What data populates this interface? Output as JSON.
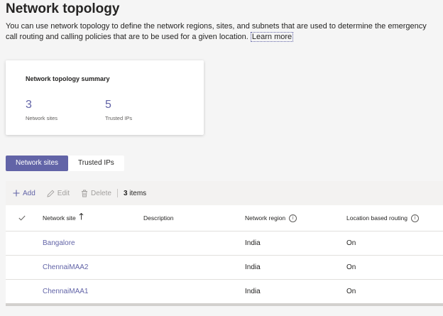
{
  "page": {
    "title": "Network topology",
    "description": "You can use network topology to define the network regions, sites, and subnets that are used to determine the emergency call routing and calling policies that are to be used for a given location.",
    "learn_more": "Learn more"
  },
  "summary": {
    "title": "Network topology summary",
    "stats": [
      {
        "value": "3",
        "label": "Network sites"
      },
      {
        "value": "5",
        "label": "Trusted IPs"
      }
    ]
  },
  "tabs": [
    {
      "label": "Network sites",
      "active": true
    },
    {
      "label": "Trusted IPs",
      "active": false
    }
  ],
  "toolbar": {
    "add": "Add",
    "edit": "Edit",
    "delete": "Delete",
    "count": "3",
    "count_suffix": "items"
  },
  "table": {
    "columns": [
      "Network site",
      "Description",
      "Network region",
      "Location based routing"
    ],
    "rows": [
      {
        "site": "Bangalore",
        "description": "",
        "region": "India",
        "lbr": "On"
      },
      {
        "site": "ChennaiMAA2",
        "description": "",
        "region": "India",
        "lbr": "On"
      },
      {
        "site": "ChennaiMAA1",
        "description": "",
        "region": "India",
        "lbr": "On"
      }
    ]
  },
  "colors": {
    "accent": "#6264a7",
    "background": "#f5f5f5"
  },
  "icons": {
    "add": "plus-icon",
    "edit": "pencil-icon",
    "delete": "trash-icon",
    "select_all": "checkmark-icon",
    "sort": "sort-ascending-icon",
    "info": "info-icon"
  }
}
